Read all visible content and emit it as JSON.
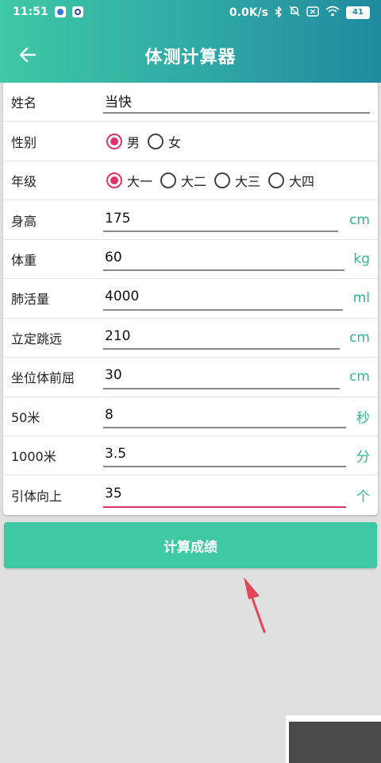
{
  "status_bar": {
    "time": "11:51",
    "net_speed": "0.0K/s",
    "battery": "41",
    "icons": [
      "app-icon-1",
      "app-icon-2",
      "bluetooth-icon",
      "mute-icon",
      "sim-icon",
      "wifi-icon",
      "battery-icon"
    ]
  },
  "app_bar": {
    "title": "体测计算器",
    "back_icon": "back-arrow-icon"
  },
  "form": {
    "name": {
      "label": "姓名",
      "value": "当快"
    },
    "gender": {
      "label": "性别",
      "options": [
        {
          "label": "男",
          "checked": true
        },
        {
          "label": "女",
          "checked": false
        }
      ]
    },
    "grade": {
      "label": "年级",
      "options": [
        {
          "label": "大一",
          "checked": true
        },
        {
          "label": "大二",
          "checked": false
        },
        {
          "label": "大三",
          "checked": false
        },
        {
          "label": "大四",
          "checked": false
        }
      ]
    },
    "height": {
      "label": "身高",
      "value": "175",
      "unit": "cm"
    },
    "weight": {
      "label": "体重",
      "value": "60",
      "unit": "kg"
    },
    "lung": {
      "label": "肺活量",
      "value": "4000",
      "unit": "ml"
    },
    "jump": {
      "label": "立定跳远",
      "value": "210",
      "unit": "cm"
    },
    "reach": {
      "label": "坐位体前屈",
      "value": "30",
      "unit": "cm"
    },
    "run50": {
      "label": "50米",
      "value": "8",
      "unit": "秒"
    },
    "run1000": {
      "label": "1000米",
      "value": "3.5",
      "unit": "分"
    },
    "pullup": {
      "label": "引体向上",
      "value": "35",
      "unit": "个"
    }
  },
  "calc_button": {
    "label": "计算成绩"
  },
  "colors": {
    "accent": "#e0336e",
    "primary": "#3ec9a2",
    "unit_text": "#2fb69a"
  }
}
